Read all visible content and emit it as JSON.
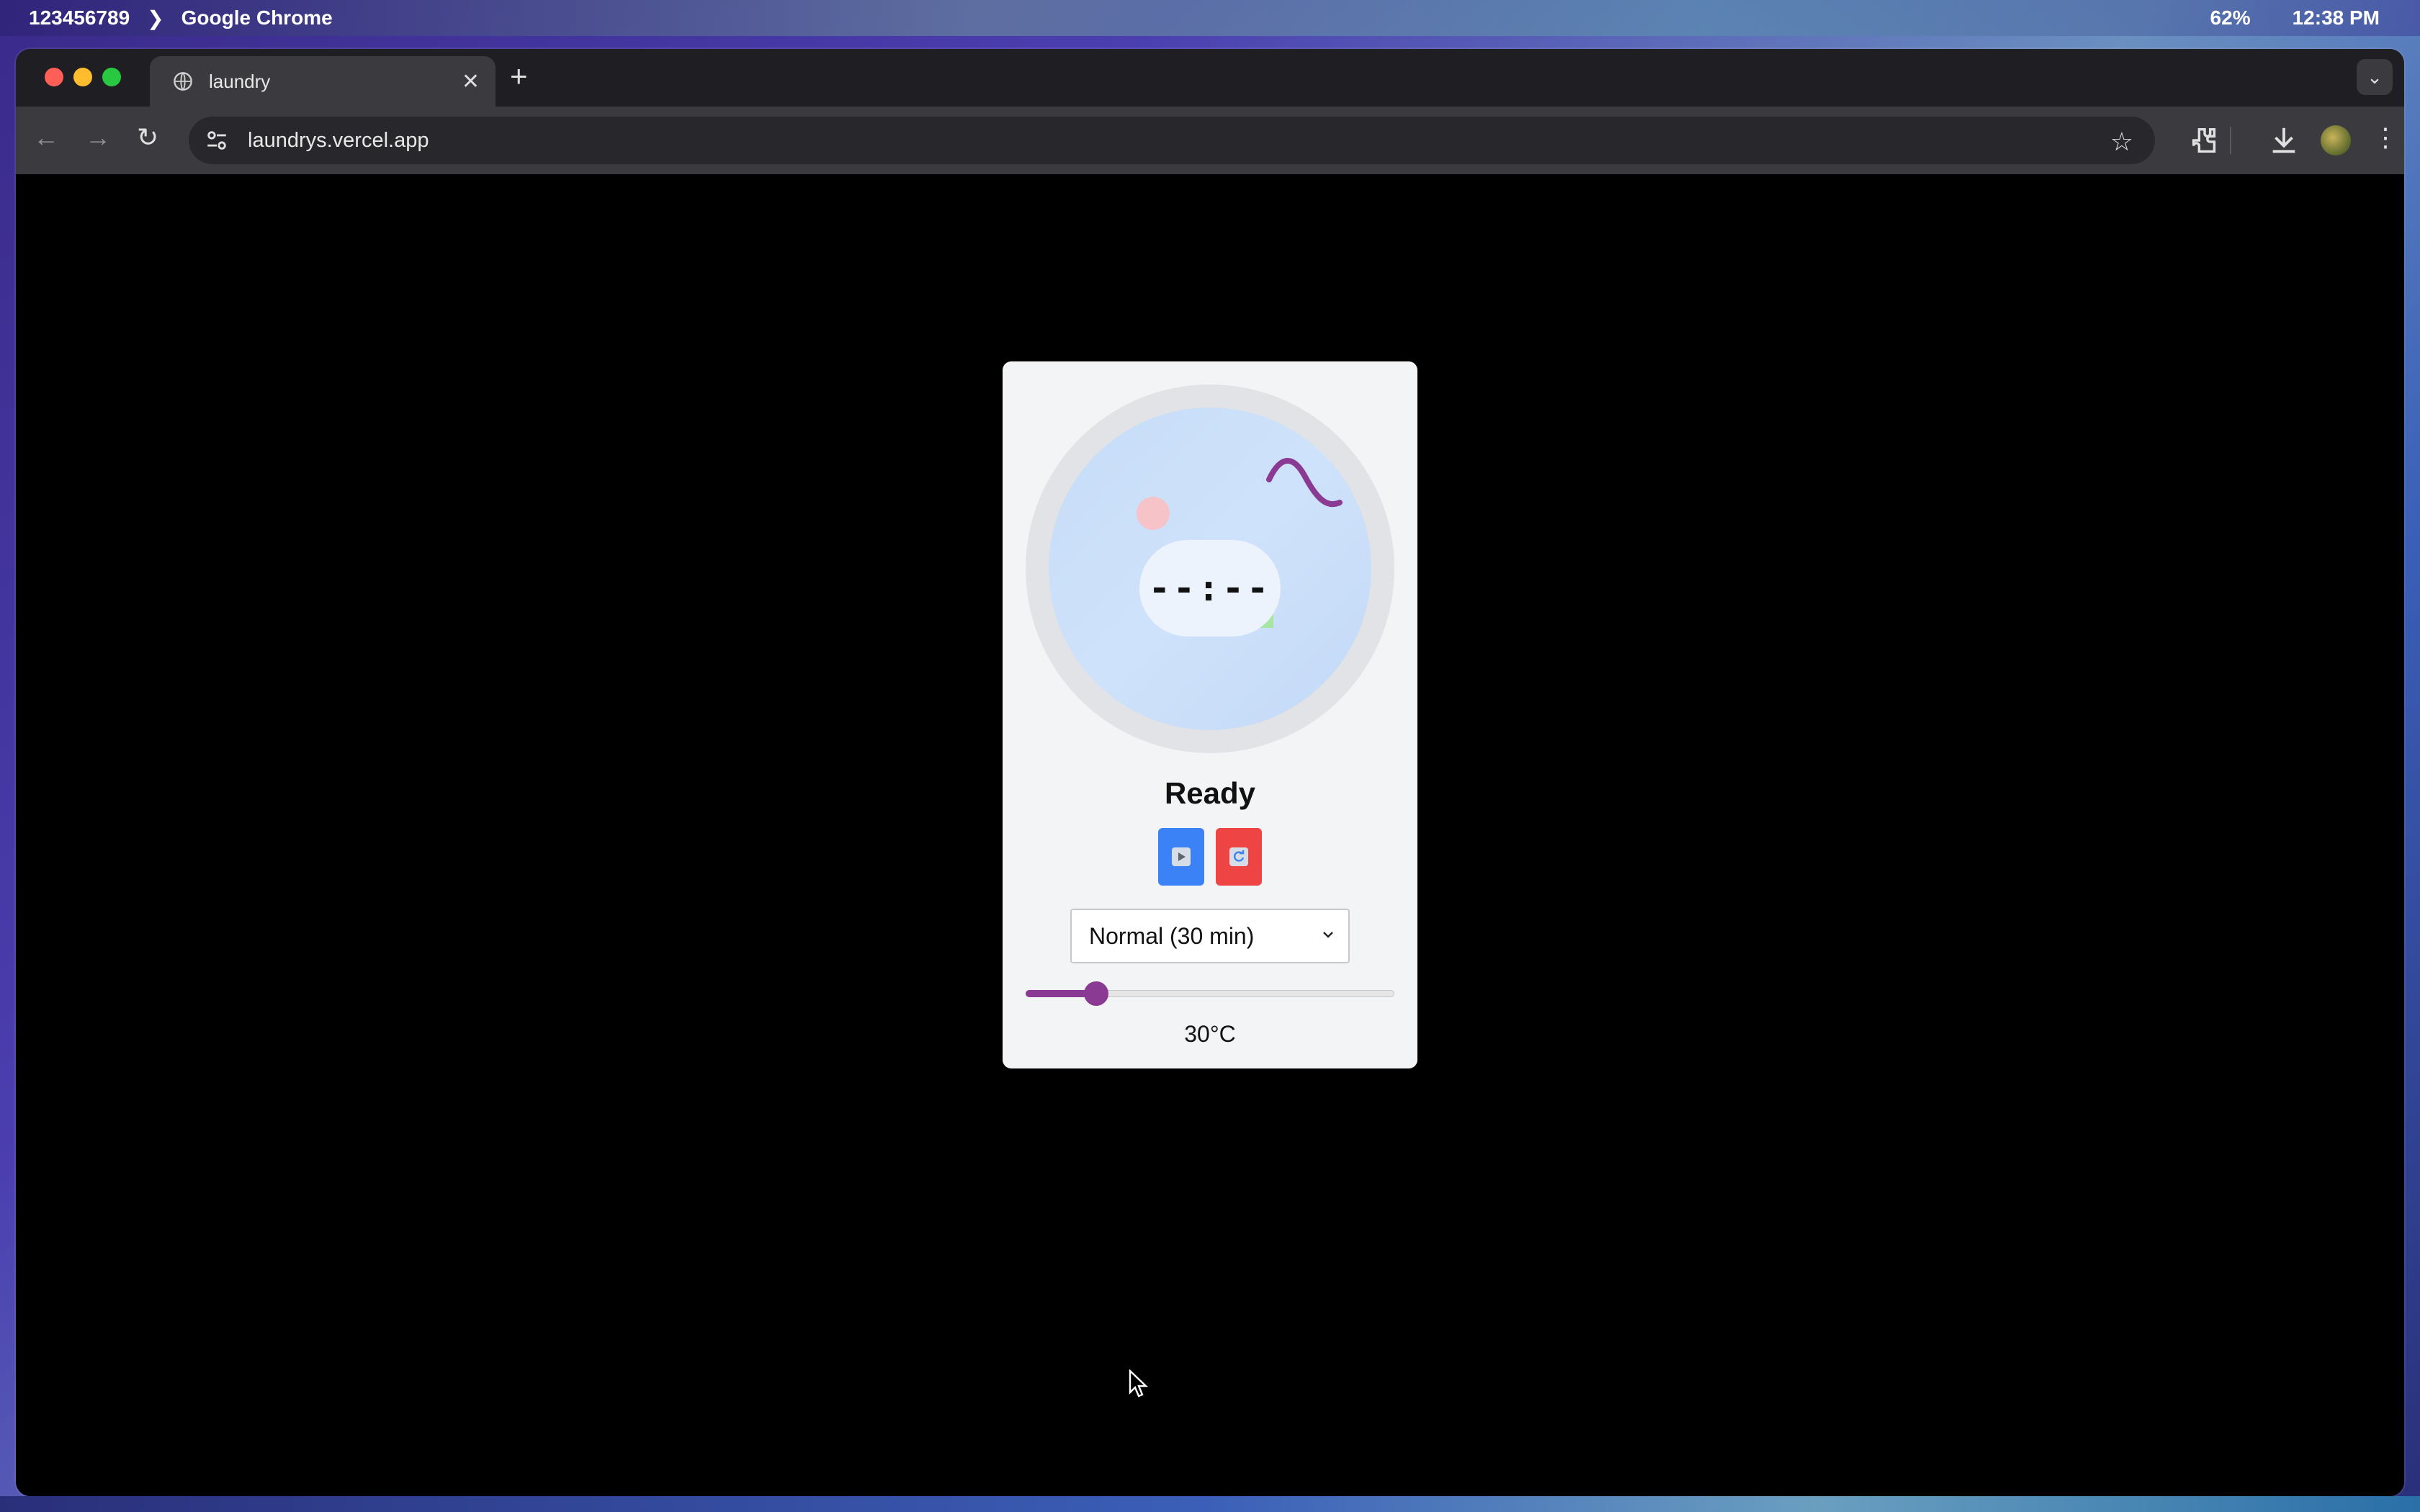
{
  "menubar": {
    "workspace": "123456789",
    "app_name": "Google Chrome",
    "battery": "62%",
    "clock": "12:38 PM"
  },
  "browser": {
    "tab_title": "laundry",
    "url": "laundrys.vercel.app"
  },
  "machine": {
    "timer": "--:--",
    "status": "Ready",
    "start_icon": "play-icon",
    "reset_icon": "refresh-icon",
    "cycle_selected": "Normal (30 min)",
    "temperature_label": "30°C",
    "temperature_level": 0.17,
    "accent_color": "#8b3a93",
    "start_color": "#3b82f6",
    "reset_color": "#ef4444"
  }
}
